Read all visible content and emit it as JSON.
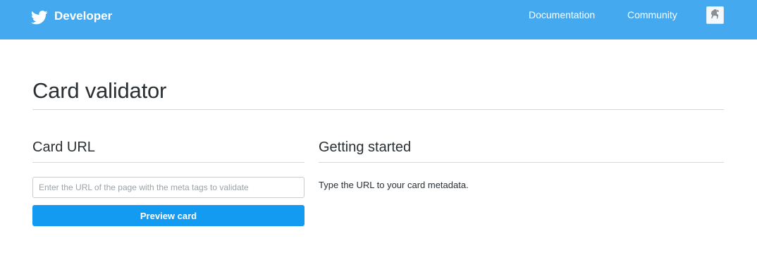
{
  "colors": {
    "header_bg": "#44a9ee",
    "button_bg": "#139bf2",
    "text": "#292f33",
    "rule": "#d5d9db"
  },
  "header": {
    "brand_icon": "twitter-bird-icon",
    "brand_label": "Developer",
    "nav": {
      "documentation": "Documentation",
      "community": "Community"
    },
    "avatar_icon": "user-avatar"
  },
  "main": {
    "title": "Card validator",
    "card_url": {
      "heading": "Card URL",
      "input_value": "",
      "input_placeholder": "Enter the URL of the page with the meta tags to validate",
      "button_label": "Preview card"
    },
    "getting_started": {
      "heading": "Getting started",
      "text": "Type the URL to your card metadata."
    }
  }
}
